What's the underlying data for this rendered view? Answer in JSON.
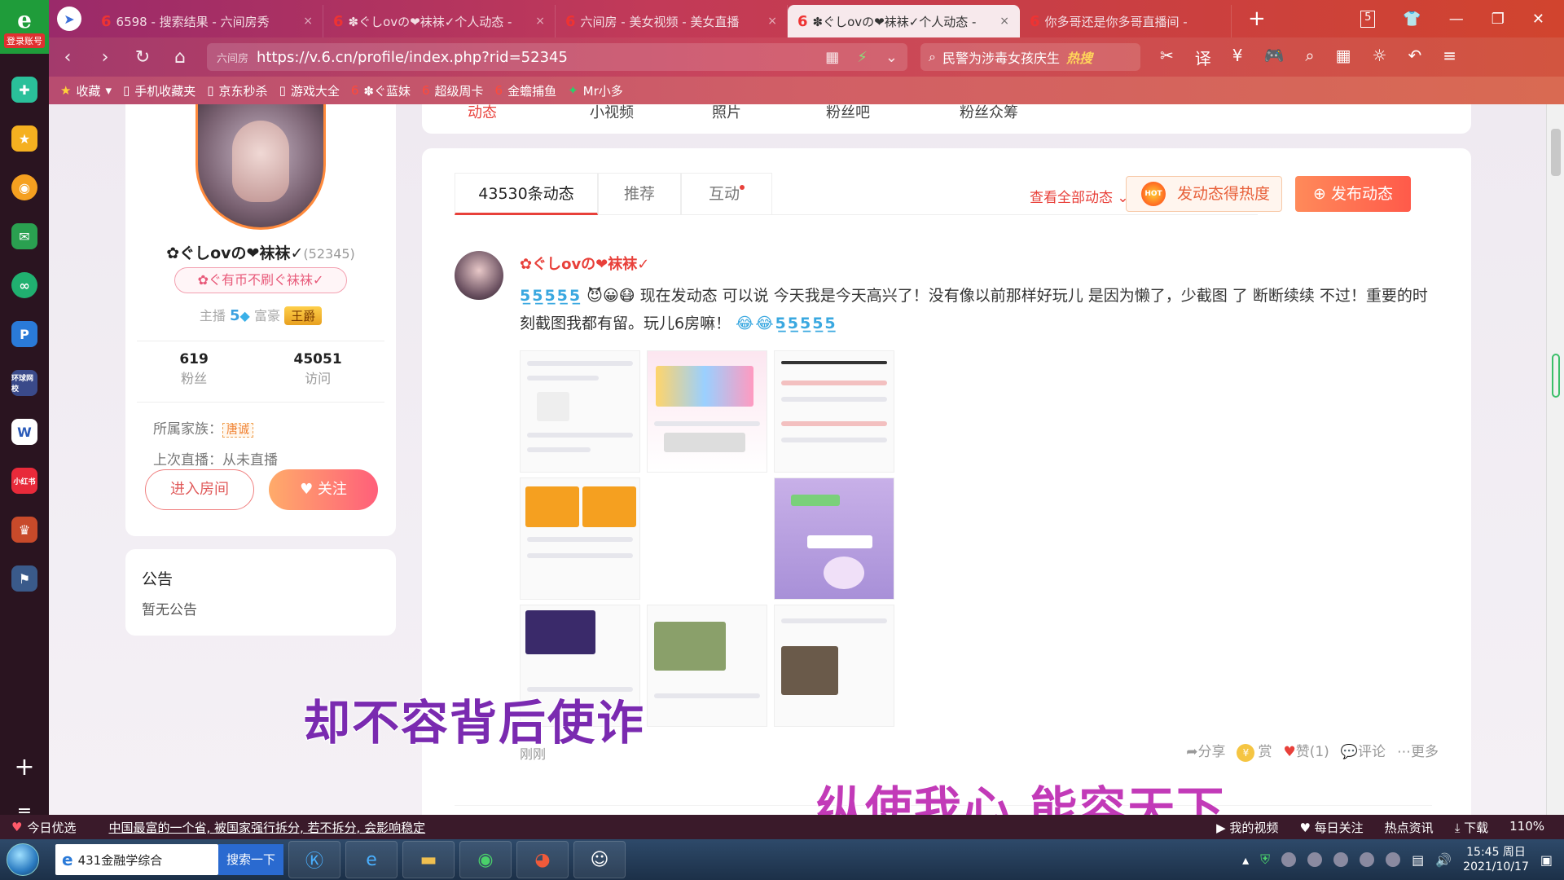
{
  "browser": {
    "tabs": [
      {
        "label": "6598 - 搜索结果 - 六间房秀",
        "active": false
      },
      {
        "label": "✽ぐしovの❤袜袜✓个人动态 - ",
        "active": false
      },
      {
        "label": "六间房 - 美女视频 - 美女直播",
        "active": false
      },
      {
        "label": "✽ぐしovの❤袜袜✓个人动态 - ",
        "active": true
      },
      {
        "label": "你多哥还是你多哥直播间 - ",
        "active": false
      }
    ],
    "url": "https://v.6.cn/profile/index.php?rid=52345",
    "site_label": "六间房",
    "search_text": "民警为涉毒女孩庆生",
    "search_badge": "热搜",
    "tab_count": "5",
    "bookmarks": [
      "收藏",
      "手机收藏夹",
      "京东秒杀",
      "游戏大全",
      "✽ぐ蓝妹",
      "超级周卡",
      "金蟾捕鱼",
      "Mr小多"
    ],
    "login_label": "登录账号"
  },
  "sidebar": {
    "icons": [
      "plus-circle-icon",
      "star-icon",
      "weibo-icon",
      "mail-icon",
      "link-icon",
      "p-app-icon",
      "news-icon",
      "word-icon",
      "xiaohongshu-icon",
      "game-icon",
      "game2-icon"
    ],
    "labels": {
      "news": "环球网校",
      "red": "小红书"
    }
  },
  "profile": {
    "name": "✿ぐしovの❤袜袜✓",
    "rid": "(52345)",
    "tag": "✿ぐ有币不刷ぐ袜袜✓",
    "anchor_label": "主播",
    "anchor_level": "5",
    "rich_label": "富豪",
    "rich_title": "王爵",
    "fans_count": "619",
    "fans_label": "粉丝",
    "visits_count": "45051",
    "visits_label": "访问",
    "family_label": "所属家族：",
    "family_name": "唐诚",
    "last_live": "上次直播：从未直播",
    "enter_button": "进入房间",
    "follow_button": "关注"
  },
  "notice": {
    "title": "公告",
    "content": "暂无公告"
  },
  "topnav": [
    "动态",
    "小视频",
    "照片",
    "粉丝吧",
    "粉丝众筹"
  ],
  "feed": {
    "tabs": [
      "43530条动态",
      "推荐",
      "互动"
    ],
    "view_all": "查看全部动态",
    "heat_button": "发动态得热度",
    "hot_badge": "HOT",
    "post_button": "发布动态",
    "post": {
      "author": "✿ぐしovの❤袜袜✓",
      "emoji_prefix": "5̲5̲5̲5̲5̲",
      "text": "现在发动态 可以说 今天我是今天高兴了！没有像以前那样好玩儿 是因为懒了，少截图 了 断断续续 不过！重要的时刻截图我都有留。玩儿6房嘛！",
      "emoji_suffix": "😂😂5̲5̲5̲5̲5̲",
      "time": "刚刚",
      "actions": [
        "分享",
        "赏",
        "赞(1)",
        "评论",
        "更多"
      ]
    }
  },
  "captions": {
    "left": "却不容背后使诈",
    "right": "纵使我心  能容天下"
  },
  "statusbar": {
    "pick": "今日优选",
    "news": "中国最富的一个省, 被国家强行拆分, 若不拆分, 会影响稳定",
    "items": [
      "我的视频",
      "每日关注",
      "热点资讯",
      "下载",
      "110%"
    ]
  },
  "taskbar": {
    "search_value": "431金融学综合",
    "search_button": "搜索一下",
    "time": "15:45 周日",
    "date": "2021/10/17"
  }
}
